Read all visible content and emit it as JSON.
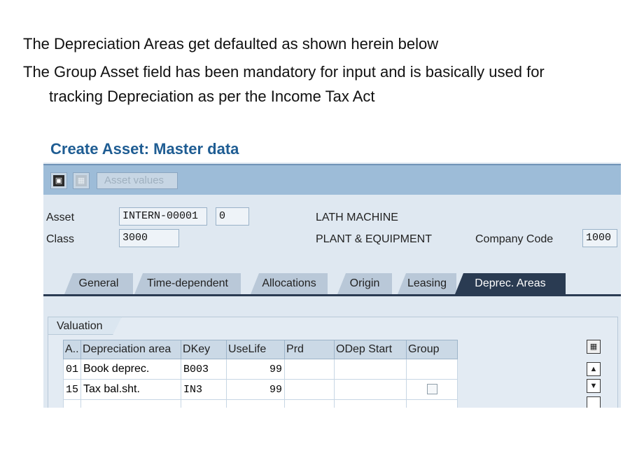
{
  "slide": {
    "line1": "The Depreciation Areas get defaulted as shown herein below",
    "line2": "The Group Asset field has been mandatory for input and is basically used for",
    "line2b": "tracking Depreciation as per the Income Tax Act"
  },
  "window": {
    "title": "Create Asset:  Master data"
  },
  "toolbar": {
    "asset_values_label": "Asset values"
  },
  "header": {
    "asset_label": "Asset",
    "asset_value": "INTERN-00001",
    "subnumber_value": "0",
    "asset_description": "LATH MACHINE",
    "class_label": "Class",
    "class_value": "3000",
    "class_description": "PLANT & EQUIPMENT",
    "company_code_label": "Company Code",
    "company_code_value": "1000"
  },
  "tabs": [
    {
      "label": "General"
    },
    {
      "label": "Time-dependent"
    },
    {
      "label": "Allocations"
    },
    {
      "label": "Origin"
    },
    {
      "label": "Leasing"
    },
    {
      "label": "Deprec. Areas",
      "active": true
    }
  ],
  "valuation": {
    "title": "Valuation",
    "columns": [
      "A..",
      "Depreciation area",
      "DKey",
      "UseLife",
      "Prd",
      "ODep Start",
      "Group"
    ],
    "rows": [
      {
        "area": "01",
        "name": "Book deprec.",
        "dkey": "B003",
        "uselife": "99",
        "prd": "",
        "odep": "",
        "group": false
      },
      {
        "area": "15",
        "name": "Tax bal.sht.",
        "dkey": "IN3",
        "uselife": "99",
        "prd": "",
        "odep": "",
        "group": true
      }
    ]
  },
  "icons": [
    "save-icon",
    "details-icon",
    "table-settings-icon",
    "scroll-up-icon",
    "scroll-down-icon"
  ]
}
